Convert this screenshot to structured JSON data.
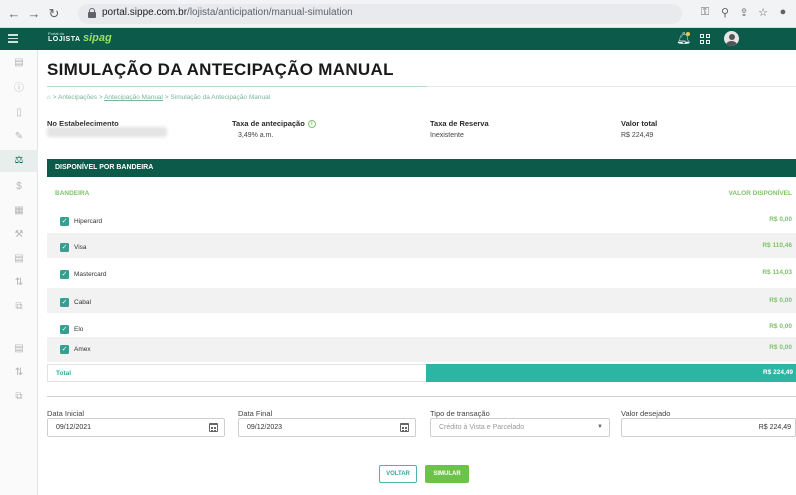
{
  "browser": {
    "url_host": "portal.sippe.com.br",
    "url_path": "/lojista/anticipation/manual-simulation"
  },
  "header": {
    "portal_label": "Portal do",
    "lojista_label": "LOJISTA",
    "brand": "sipag",
    "colors": {
      "primary": "#0c5a4a",
      "accent": "#6cc24a",
      "teal": "#2bb5a3"
    }
  },
  "page": {
    "title": "SIMULAÇÃO DA ANTECIPAÇÃO MANUAL",
    "breadcrumb": {
      "home_icon": "home-icon",
      "item1": "Antecipações",
      "item2": "Antecipação Manual",
      "item3": "Simulação da Antecipação Manual"
    }
  },
  "info": {
    "establishment_label": "No Estabelecimento",
    "rate_label": "Taxa de antecipação",
    "rate_value": "3,49% a.m.",
    "reserve_label": "Taxa de Reserva",
    "reserve_value": "Inexistente",
    "total_label": "Valor total",
    "total_value": "R$ 224,49"
  },
  "panel": {
    "title": "DISPONÍVEL POR BANDEIRA",
    "col_brand": "BANDEIRA",
    "col_value": "VALOR DISPONÍVEL",
    "rows": [
      {
        "brand": "Hipercard",
        "value": "R$ 0,00",
        "checked": true
      },
      {
        "brand": "Visa",
        "value": "R$ 110,46",
        "checked": true
      },
      {
        "brand": "Mastercard",
        "value": "R$ 114,03",
        "checked": true
      },
      {
        "brand": "Cabal",
        "value": "R$ 0,00",
        "checked": true
      },
      {
        "brand": "Elo",
        "value": "R$ 0,00",
        "checked": true
      },
      {
        "brand": "Amex",
        "value": "R$ 0,00",
        "checked": true
      }
    ],
    "total_label": "Total",
    "total_value": "R$ 224,49"
  },
  "form": {
    "start_label": "Data Inicial",
    "start_value": "09/12/2021",
    "end_label": "Data Final",
    "end_value": "09/12/2023",
    "type_label": "Tipo de transação",
    "type_placeholder": "Crédito à Vista e Parcelado",
    "amount_label": "Valor desejado",
    "amount_value": "R$ 224,49"
  },
  "actions": {
    "back": "VOLTAR",
    "simulate": "SIMULAR"
  }
}
